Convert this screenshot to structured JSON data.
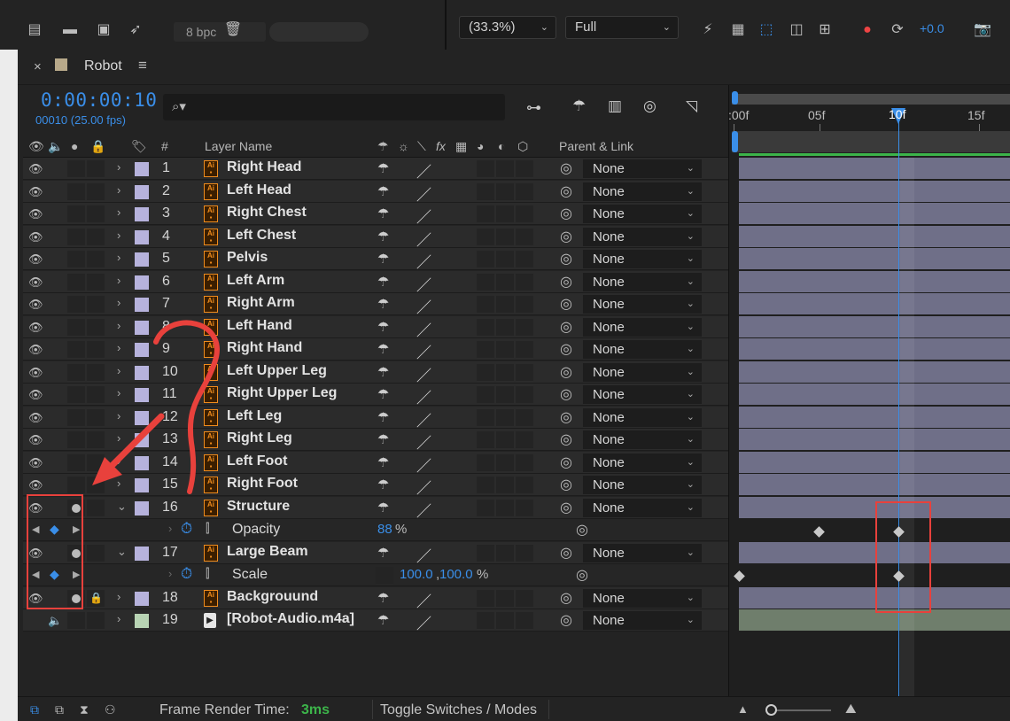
{
  "top_toolbar": {
    "bpc_label": "8 bpc",
    "zoom_value": "(33.3%)",
    "resolution_value": "Full",
    "exposure_value": "+0.0"
  },
  "comp_tab": {
    "title": "Robot"
  },
  "timeline": {
    "timecode": "0:00:00:10",
    "frame_info": "00010 (25.00 fps)",
    "ruler_ticks": [
      ":00f",
      "05f",
      "10f",
      "15f"
    ]
  },
  "headers": {
    "hash": "#",
    "layer_name": "Layer Name",
    "parent_link": "Parent & Link",
    "fx": "fx"
  },
  "layers": [
    {
      "num": "1",
      "name": "Right Head",
      "parent": "None"
    },
    {
      "num": "2",
      "name": "Left Head",
      "parent": "None"
    },
    {
      "num": "3",
      "name": "Right Chest",
      "parent": "None"
    },
    {
      "num": "4",
      "name": "Left Chest",
      "parent": "None"
    },
    {
      "num": "5",
      "name": "Pelvis",
      "parent": "None"
    },
    {
      "num": "6",
      "name": "Left Arm",
      "parent": "None"
    },
    {
      "num": "7",
      "name": "Right Arm",
      "parent": "None"
    },
    {
      "num": "8",
      "name": "Left Hand",
      "parent": "None"
    },
    {
      "num": "9",
      "name": "Right Hand",
      "parent": "None"
    },
    {
      "num": "10",
      "name": "Left Upper Leg",
      "parent": "None"
    },
    {
      "num": "11",
      "name": "Right Upper Leg",
      "parent": "None"
    },
    {
      "num": "12",
      "name": "Left Leg",
      "parent": "None"
    },
    {
      "num": "13",
      "name": "Right Leg",
      "parent": "None"
    },
    {
      "num": "14",
      "name": "Left Foot",
      "parent": "None"
    },
    {
      "num": "15",
      "name": "Right Foot",
      "parent": "None"
    },
    {
      "num": "16",
      "name": "Structure",
      "parent": "None"
    },
    {
      "num": "17",
      "name": "Large Beam",
      "parent": "None"
    },
    {
      "num": "18",
      "name": "Backgrouund",
      "parent": "None"
    },
    {
      "num": "19",
      "name": "[Robot-Audio.m4a]",
      "parent": "None"
    }
  ],
  "properties": {
    "opacity": {
      "name": "Opacity",
      "value": "88",
      "unit": "%"
    },
    "scale": {
      "name": "Scale",
      "value_x": "100.0",
      "separator": ",",
      "value_y": "100.0",
      "unit": "%"
    }
  },
  "footer": {
    "render_label": "Frame Render Time:",
    "render_value": "3ms",
    "toggle_label": "Toggle Switches / Modes"
  },
  "colors": {
    "accent_blue": "#3a8ee8",
    "label_lavender": "#b6b2dc",
    "label_sage": "#b8d4b4",
    "layer_bar": "#6f6f88",
    "annotation_red": "#e8413c"
  }
}
